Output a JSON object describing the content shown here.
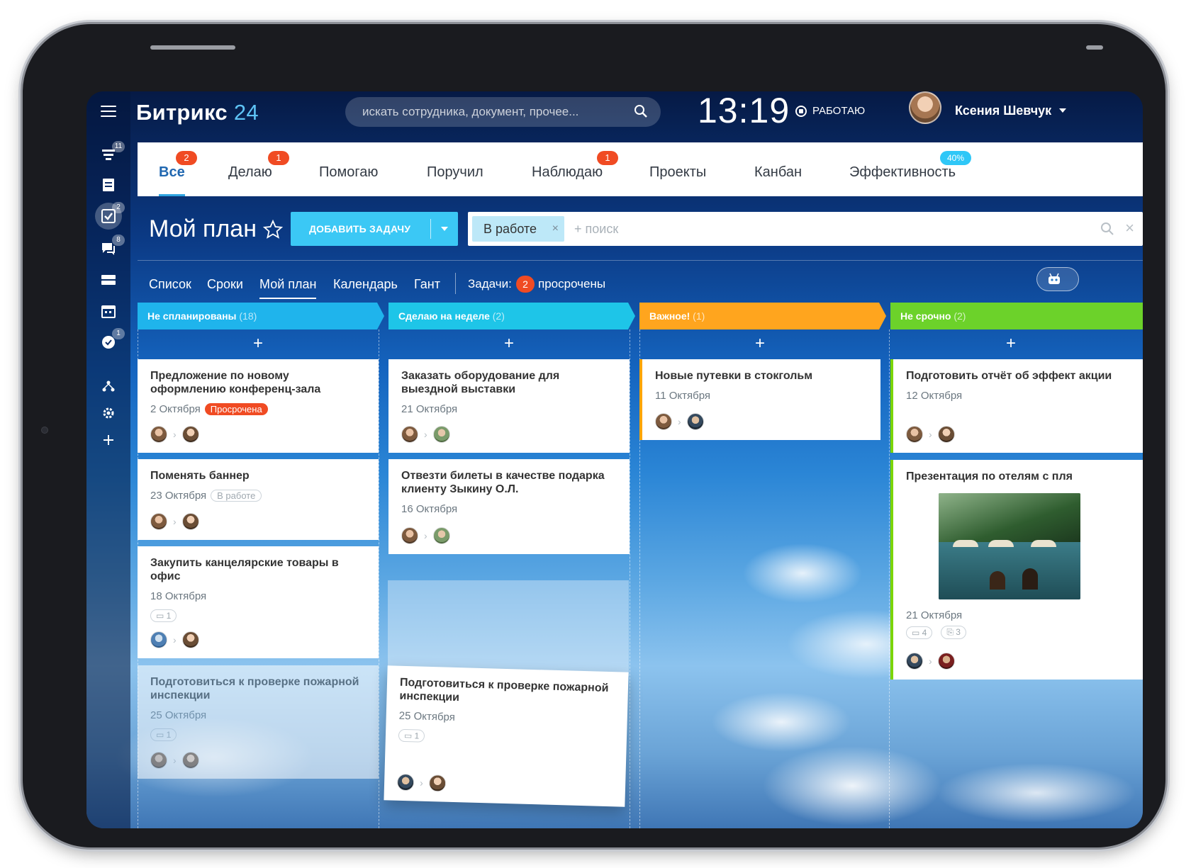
{
  "header": {
    "brand": "Битрикс",
    "brand_num": "24",
    "search_placeholder": "искать сотрудника, документ, прочее...",
    "clock": "13:19",
    "status": "РАБОТАЮ",
    "user_name": "Ксения Шевчук"
  },
  "sidebar": {
    "badges": [
      "11",
      "2",
      "8",
      "1"
    ]
  },
  "tabs": [
    {
      "label": "Все",
      "badge": "2"
    },
    {
      "label": "Делаю",
      "badge": "1"
    },
    {
      "label": "Помогаю",
      "badge": ""
    },
    {
      "label": "Поручил",
      "badge": ""
    },
    {
      "label": "Наблюдаю",
      "badge": "1"
    },
    {
      "label": "Проекты",
      "badge": ""
    },
    {
      "label": "Канбан",
      "badge": ""
    },
    {
      "label": "Эффективность",
      "badge": "40%"
    }
  ],
  "page": {
    "title": "Мой план",
    "add_task": "ДОБАВИТЬ ЗАДАЧУ",
    "filter_chip": "В работе",
    "filter_search": "+ поиск"
  },
  "views": {
    "list": "Список",
    "deadlines": "Сроки",
    "my_plan": "Мой план",
    "calendar": "Календарь",
    "gantt": "Гант",
    "tasks_label": "Задачи:",
    "tasks_count": "2",
    "tasks_overdue": "просрочены"
  },
  "columns": [
    {
      "title": "Не спланированы",
      "count": "(18)",
      "color": "#1fb4ec"
    },
    {
      "title": "Сделаю на неделе",
      "count": "(2)",
      "color": "#1ec5e8"
    },
    {
      "title": "Важное!",
      "count": "(1)",
      "color": "#ffa51e"
    },
    {
      "title": "Не срочно",
      "count": "(2)",
      "color": "#6cd22a"
    }
  ],
  "cards": {
    "c1": {
      "title": "Предложение по новому оформлению конференц-зала",
      "date": "2 Октября",
      "tag": "Просрочена"
    },
    "c2": {
      "title": "Поменять баннер",
      "date": "23 Октября",
      "tag": "В работе"
    },
    "c3": {
      "title": "Закупить канцелярские товары в офис",
      "date": "18 Октября",
      "comments": "1"
    },
    "c4": {
      "title": "Подготовиться к проверке пожарной инспекции",
      "date": "25 Октября",
      "comments": "1"
    },
    "c5": {
      "title": "Заказать оборудование для выездной выставки",
      "date": "21 Октября"
    },
    "c6": {
      "title": "Отвезти билеты в качестве подарка клиенту Зыкину О.Л.",
      "date": "16 Октября"
    },
    "c7": {
      "title": "Подготовиться к проверке пожарной инспекции",
      "date": "25 Октября",
      "comments": "1"
    },
    "c8": {
      "title": "Новые путевки в стокгольм",
      "date": "11 Октября"
    },
    "c9": {
      "title": "Подготовить отчёт об эффект акции",
      "date": "12 Октября"
    },
    "c10": {
      "title": "Презентация по отелям с пля",
      "date": "21 Октября",
      "comments": "4",
      "files": "3"
    }
  }
}
